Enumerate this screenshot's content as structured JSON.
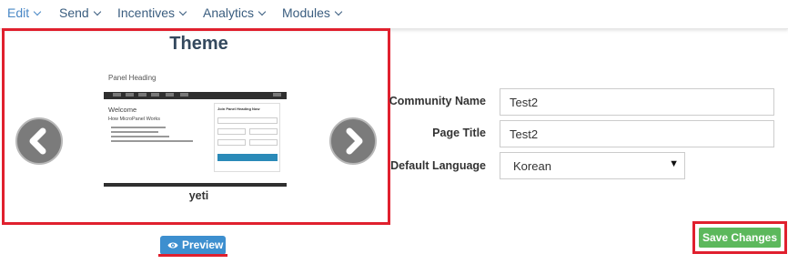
{
  "nav": {
    "items": [
      {
        "label": "Edit"
      },
      {
        "label": "Send"
      },
      {
        "label": "Incentives"
      },
      {
        "label": "Analytics"
      },
      {
        "label": "Modules"
      }
    ]
  },
  "theme": {
    "title": "Theme",
    "name": "yeti",
    "thumbnail": {
      "heading": "Panel Heading",
      "welcome": "Welcome",
      "how": "How MicroPanel Works",
      "form_title": "Join Panel Heading Now"
    }
  },
  "preview": {
    "label": "Preview"
  },
  "form": {
    "community_name": {
      "label": "Community Name",
      "value": "Test2"
    },
    "page_title": {
      "label": "Page Title",
      "value": "Test2"
    },
    "default_language": {
      "label": "Default Language",
      "value": "Korean"
    }
  },
  "save": {
    "label": "Save Changes"
  },
  "colors": {
    "highlight": "#e0202e",
    "primary": "#3d8fcf",
    "success": "#5cb85c",
    "heading": "#34495e"
  }
}
